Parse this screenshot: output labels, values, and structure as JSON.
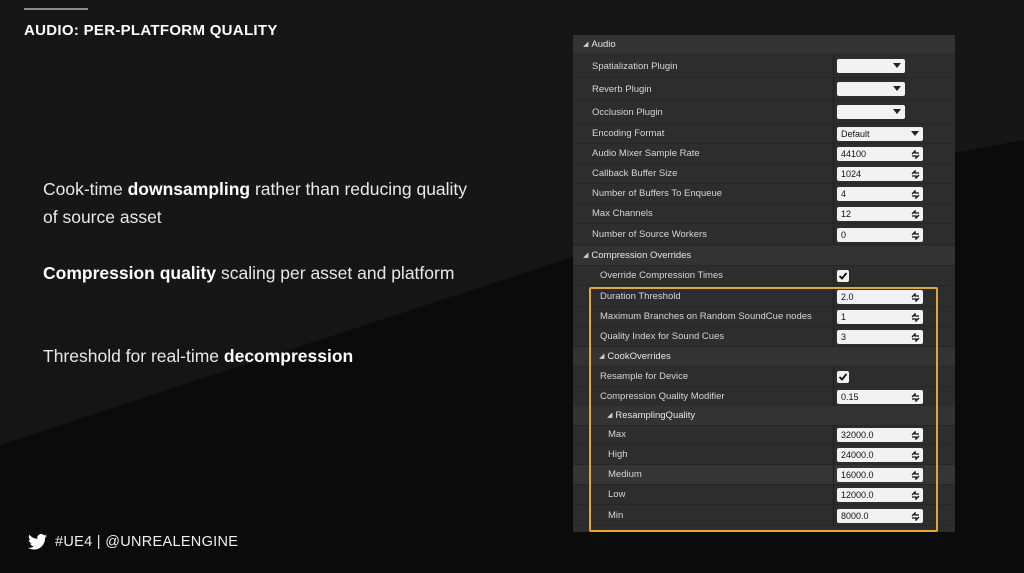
{
  "slide": {
    "title": "AUDIO: PER-PLATFORM QUALITY",
    "bullets": [
      {
        "bold_first": false,
        "pre": "Cook-time ",
        "bold": "downsampling",
        "post": " rather than reducing quality of source asset"
      },
      {
        "pre": "",
        "bold": "Compression quality",
        "post": " scaling per asset and platform"
      },
      {
        "pre": "Threshold for real-time ",
        "bold": "decompression",
        "post": ""
      }
    ],
    "footer": "#UE4 | @UNREALENGINE"
  },
  "panel": {
    "section": "Audio",
    "rows": [
      {
        "label": "Spatialization Plugin",
        "type": "combo",
        "value": ""
      },
      {
        "label": "Reverb Plugin",
        "type": "combo",
        "value": ""
      },
      {
        "label": "Occlusion Plugin",
        "type": "combo",
        "value": ""
      },
      {
        "label": "Encoding Format",
        "type": "combo-wide",
        "value": "Default"
      },
      {
        "label": "Audio Mixer Sample Rate",
        "type": "num",
        "value": "44100"
      },
      {
        "label": "Callback Buffer Size",
        "type": "num",
        "value": "1024"
      },
      {
        "label": "Number of Buffers To Enqueue",
        "type": "num",
        "value": "4"
      },
      {
        "label": "Max Channels",
        "type": "num",
        "value": "12"
      },
      {
        "label": "Number of Source Workers",
        "type": "num",
        "value": "0"
      }
    ],
    "compression_overrides": {
      "header": "Compression Overrides",
      "rows": [
        {
          "label": "Override Compression Times",
          "type": "check",
          "checked": true
        },
        {
          "label": "Duration Threshold",
          "type": "num",
          "value": "2.0"
        },
        {
          "label": "Maximum Branches on Random SoundCue nodes",
          "type": "num",
          "value": "1"
        },
        {
          "label": "Quality Index for Sound Cues",
          "type": "num",
          "value": "3"
        }
      ]
    },
    "cook_overrides": {
      "header": "CookOverrides",
      "rows": [
        {
          "label": "Resample for Device",
          "type": "check",
          "checked": true
        },
        {
          "label": "Compression Quality Modifier",
          "type": "num",
          "value": "0.15"
        }
      ]
    },
    "resampling_quality": {
      "header": "ResamplingQuality",
      "rows": [
        {
          "label": "Max",
          "value": "32000.0"
        },
        {
          "label": "High",
          "value": "24000.0"
        },
        {
          "label": "Medium",
          "value": "16000.0"
        },
        {
          "label": "Low",
          "value": "12000.0"
        },
        {
          "label": "Min",
          "value": "8000.0"
        }
      ]
    }
  },
  "colors": {
    "highlight": "#e0a83a",
    "panel_bg": "#2d2d2d",
    "slide_bg": "#0d0d0d"
  }
}
